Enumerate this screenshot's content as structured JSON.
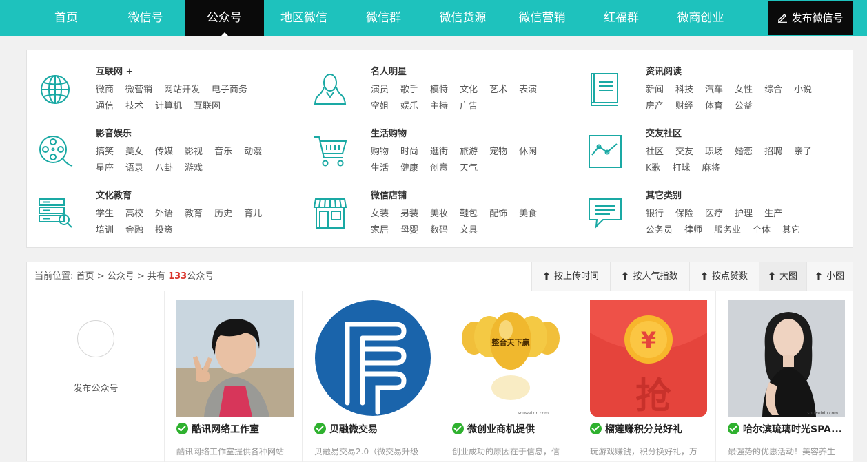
{
  "nav": {
    "items": [
      "首页",
      "微信号",
      "公众号",
      "地区微信",
      "微信群",
      "微信货源",
      "微信营销",
      "红福群",
      "微商创业"
    ],
    "active_index": 2,
    "publish_label": "发布微信号"
  },
  "categories": [
    {
      "title": "互联网 +",
      "icon": "globe-icon",
      "lines": [
        [
          "微商",
          "微营销",
          "网站开发",
          "电子商务"
        ],
        [
          "通信",
          "技术",
          "计算机",
          "互联网"
        ]
      ]
    },
    {
      "title": "名人明星",
      "icon": "person-icon",
      "lines": [
        [
          "演员",
          "歌手",
          "模特",
          "文化",
          "艺术",
          "表演"
        ],
        [
          "空姐",
          "娱乐",
          "主持",
          "广告"
        ]
      ]
    },
    {
      "title": "资讯阅读",
      "icon": "book-icon",
      "lines": [
        [
          "新闻",
          "科技",
          "汽车",
          "女性",
          "综合",
          "小说"
        ],
        [
          "房产",
          "财经",
          "体育",
          "公益"
        ]
      ]
    },
    {
      "title": "影音娱乐",
      "icon": "film-reel-icon",
      "lines": [
        [
          "搞笑",
          "美女",
          "传媒",
          "影视",
          "音乐",
          "动漫"
        ],
        [
          "星座",
          "语录",
          "八卦",
          "游戏"
        ]
      ]
    },
    {
      "title": "生活购物",
      "icon": "shopping-cart-icon",
      "lines": [
        [
          "购物",
          "时尚",
          "逛街",
          "旅游",
          "宠物",
          "休闲"
        ],
        [
          "生活",
          "健康",
          "创意",
          "天气"
        ]
      ]
    },
    {
      "title": "交友社区",
      "icon": "line-chart-icon",
      "lines": [
        [
          "社区",
          "交友",
          "职场",
          "婚恋",
          "招聘",
          "亲子"
        ],
        [
          "K歌",
          "打球",
          "麻将"
        ]
      ]
    },
    {
      "title": "文化教育",
      "icon": "books-icon",
      "lines": [
        [
          "学生",
          "高校",
          "外语",
          "教育",
          "历史",
          "育儿"
        ],
        [
          "培训",
          "金融",
          "投资"
        ]
      ]
    },
    {
      "title": "微信店铺",
      "icon": "storefront-icon",
      "lines": [
        [
          "女装",
          "男装",
          "美妆",
          "鞋包",
          "配饰",
          "美食"
        ],
        [
          "家居",
          "母婴",
          "数码",
          "文具"
        ]
      ]
    },
    {
      "title": "其它类别",
      "icon": "chat-bubble-icon",
      "lines": [
        [
          "银行",
          "保险",
          "医疗",
          "护理",
          "生产"
        ],
        [
          "公务员",
          "律师",
          "服务业",
          "个体",
          "其它"
        ]
      ]
    }
  ],
  "breadcrumb": {
    "prefix": "当前位置:",
    "home": "首页",
    "sep": ">",
    "section": "公众号",
    "total_prefix": "共有",
    "count": "133",
    "total_suffix": "公众号"
  },
  "sorts": [
    "按上传时间",
    "按人气指数",
    "按点赞数",
    "大图",
    "小图"
  ],
  "add_label": "发布公众号",
  "cards": [
    {
      "title": "酷讯网络工作室",
      "desc": "酷讯网络工作室提供各种网站",
      "thumb": "girl-portrait"
    },
    {
      "title": "贝融微交易",
      "desc": "贝融易交易2.0（微交易升级",
      "thumb": "blue-logo"
    },
    {
      "title": "微创业商机提供",
      "desc": "创业成功的原因在于信息，信",
      "thumb": "golden-eggs"
    },
    {
      "title": "榴莲赚积分兑好礼",
      "desc": "玩游戏赚钱，积分换好礼，万",
      "thumb": "red-envelope"
    },
    {
      "title": "哈尔滨琉璃时光SPA...",
      "desc": "最强势的优惠活动！美容养生",
      "thumb": "woman-portrait"
    }
  ],
  "thumb_texts": {
    "eggs_label": "整合天下赢",
    "watermark": "souweixin.com",
    "coin_symbol": "¥",
    "envelope_char": "抢"
  },
  "colors": {
    "nav_bg": "#1ec2bd",
    "active_bg": "#0a0a0a",
    "accent": "#1aa9a4",
    "count": "#d9342b",
    "check": "#2fb12f"
  }
}
